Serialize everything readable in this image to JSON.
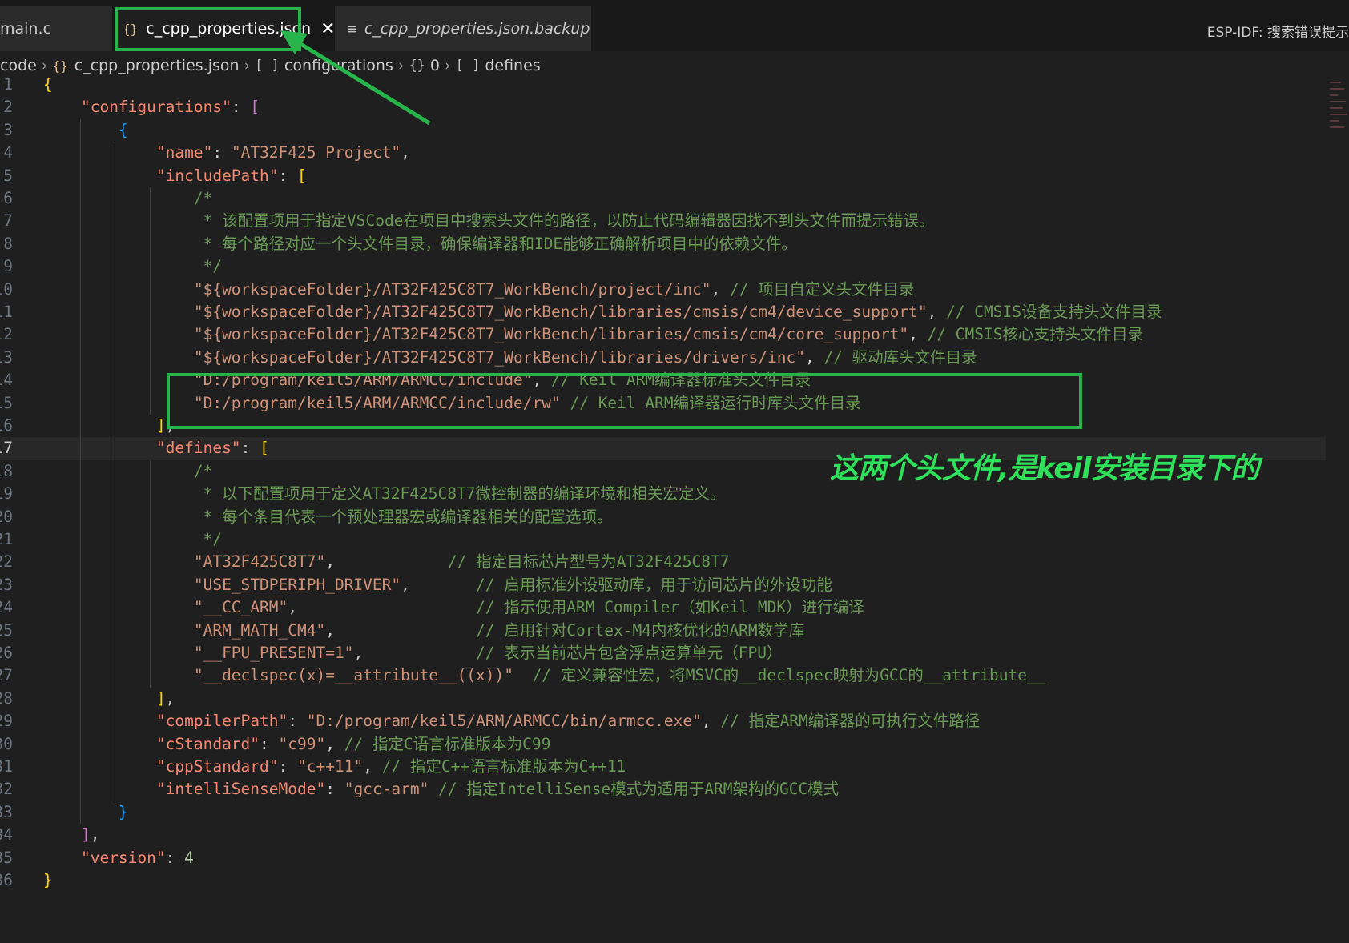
{
  "tabs": [
    {
      "label": "main.c",
      "active": false
    },
    {
      "label": "c_cpp_properties.json",
      "icon": "{}",
      "active": true,
      "close": "✕"
    },
    {
      "label": "c_cpp_properties.json.backup",
      "icon": "≡",
      "active": false
    }
  ],
  "status_right": "ESP-IDF: 搜索错误提示",
  "breadcrumb": [
    "code",
    "c_cpp_properties.json",
    "configurations",
    "0",
    "defines"
  ],
  "breadcrumb_symbols": [
    "{}",
    "[ ]",
    "{}",
    "[ ]"
  ],
  "code_lines": [
    "{",
    "    \"configurations\": [",
    "        {",
    "            \"name\": \"AT32F425 Project\",",
    "            \"includePath\": [",
    "                /*",
    "                 * 该配置项用于指定VSCode在项目中搜索头文件的路径，以防止代码编辑器因找不到头文件而提示错误。",
    "                 * 每个路径对应一个头文件目录，确保编译器和IDE能够正确解析项目中的依赖文件。",
    "                 */",
    "                \"${workspaceFolder}/AT32F425C8T7_WorkBench/project/inc\", // 项目自定义头文件目录",
    "                \"${workspaceFolder}/AT32F425C8T7_WorkBench/libraries/cmsis/cm4/device_support\", // CMSIS设备支持头文件目录",
    "                \"${workspaceFolder}/AT32F425C8T7_WorkBench/libraries/cmsis/cm4/core_support\", // CMSIS核心支持头文件目录",
    "                \"${workspaceFolder}/AT32F425C8T7_WorkBench/libraries/drivers/inc\", // 驱动库头文件目录",
    "                \"D:/program/keil5/ARM/ARMCC/include\", // Keil ARM编译器标准头文件目录",
    "                \"D:/program/keil5/ARM/ARMCC/include/rw\" // Keil ARM编译器运行时库头文件目录",
    "            ],",
    "            \"defines\": [",
    "                /*",
    "                 * 以下配置项用于定义AT32F425C8T7微控制器的编译环境和相关宏定义。",
    "                 * 每个条目代表一个预处理器宏或编译器相关的配置选项。",
    "                 */",
    "                \"AT32F425C8T7\",            // 指定目标芯片型号为AT32F425C8T7",
    "                \"USE_STDPERIPH_DRIVER\",       // 启用标准外设驱动库，用于访问芯片的外设功能",
    "                \"__CC_ARM\",                   // 指示使用ARM Compiler（如Keil MDK）进行编译",
    "                \"ARM_MATH_CM4\",               // 启用针对Cortex-M4内核优化的ARM数学库",
    "                \"__FPU_PRESENT=1\",            // 表示当前芯片包含浮点运算单元（FPU）",
    "                \"__declspec(x)=__attribute__((x))\"  // 定义兼容性宏，将MSVC的__declspec映射为GCC的__attribute__",
    "            ],",
    "            \"compilerPath\": \"D:/program/keil5/ARM/ARMCC/bin/armcc.exe\", // 指定ARM编译器的可执行文件路径",
    "            \"cStandard\": \"c99\", // 指定C语言标准版本为C99",
    "            \"cppStandard\": \"c++11\", // 指定C++语言标准版本为C++11",
    "            \"intelliSenseMode\": \"gcc-arm\" // 指定IntelliSense模式为适用于ARM架构的GCC模式",
    "        }",
    "    ],",
    "    \"version\": 4",
    "}"
  ],
  "line_numbers": [
    "1",
    "2",
    "3",
    "4",
    "5",
    "6",
    "7",
    "8",
    "9",
    "10",
    "11",
    "12",
    "13",
    "14",
    "15",
    "16",
    "17",
    "18",
    "19",
    "20",
    "21",
    "22",
    "23",
    "24",
    "25",
    "26",
    "27",
    "28",
    "29",
    "30",
    "31",
    "32",
    "33",
    "34",
    "35",
    "36"
  ],
  "current_line": 17,
  "annotation": {
    "text": "这两个头文件,是keil安装目录下的",
    "color": "#27b44b"
  },
  "colors": {
    "editor_bg": "#1f1f1f",
    "property_key": "#f48771",
    "string": "#ce9178",
    "comment": "#6a9955",
    "number": "#b5cea8",
    "bracket_gold": "#ffd700",
    "bracket_purple": "#da70d6",
    "bracket_blue": "#179fff"
  }
}
